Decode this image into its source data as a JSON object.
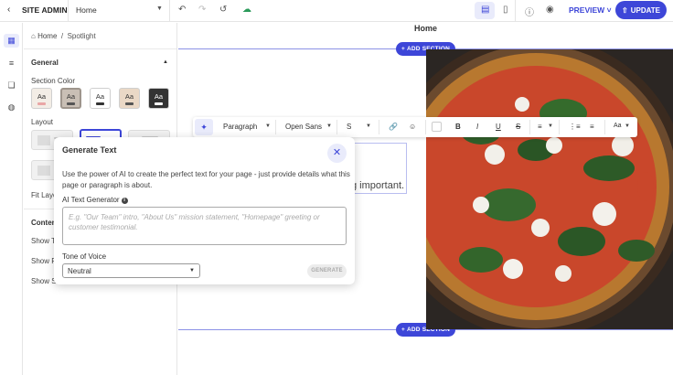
{
  "topbar": {
    "site_admin": "SITE ADMIN",
    "page_select": "Home",
    "preview": "PREVIEW",
    "update": "UPDATE"
  },
  "panel": {
    "breadcrumb_home": "Home",
    "breadcrumb_sep": "/",
    "breadcrumb_current": "Spotlight",
    "general_title": "General",
    "section_color_label": "Section Color",
    "swatch_text": "Aa",
    "layout_label": "Layout",
    "fit_layout_label": "Fit Layo",
    "content_title": "Conten",
    "show_items": [
      "Show T",
      "Show P",
      "Show S"
    ]
  },
  "canvas": {
    "page_title": "Home",
    "add_section": "ADD SECTION",
    "visible_text": "g important."
  },
  "toolbar": {
    "paragraph": "Paragraph",
    "font": "Open Sans",
    "size": "S",
    "bold": "B",
    "italic": "I",
    "underline": "U",
    "strike": "S",
    "text_size": "Aa"
  },
  "modal": {
    "title": "Generate Text",
    "description": "Use the power of AI to create the perfect text for your page - just provide details what this page or paragraph is about.",
    "ai_label": "AI Text Generator",
    "placeholder": "E.g. \"Our Team\" intro, \"About Us\" mission statement, \"Homepage\" greeting or customer testimonial.",
    "tone_label": "Tone of Voice",
    "tone_value": "Neutral",
    "generate": "GENERATE"
  },
  "colors": {
    "accent": "#3d46d8",
    "accent_light": "#e9ebfb"
  }
}
